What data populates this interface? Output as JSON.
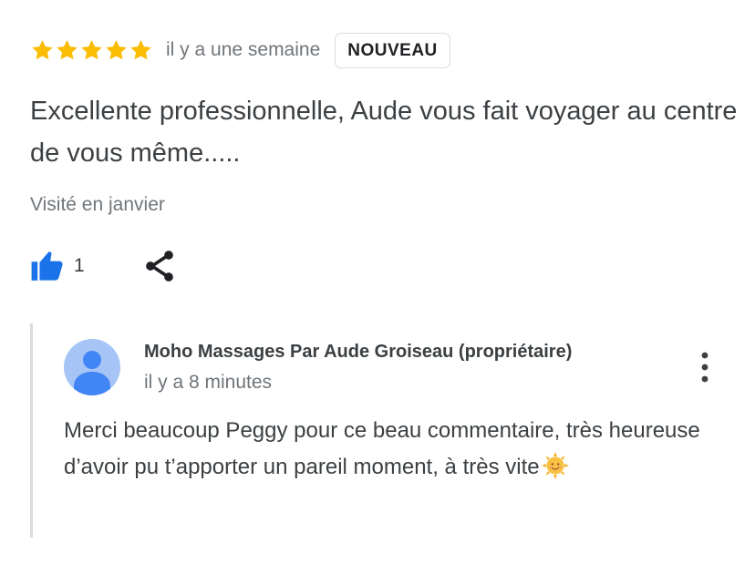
{
  "review": {
    "rating": 5,
    "time_ago": "il y a une semaine",
    "badge": "NOUVEAU",
    "text": "Excellente professionnelle, Aude vous fait voyager au centre de vous même.....",
    "visited": "Visité en janvier",
    "like_count": "1",
    "star_color": "#fbbc04"
  },
  "owner_reply": {
    "author": "Moho Massages Par Aude Groiseau (propriétaire)",
    "time_ago": "il y a 8 minutes",
    "text": "Merci beaucoup Peggy pour ce beau commentaire, très heureuse d’avoir pu t’apporter un pareil moment, à très vite",
    "emoji": "sun-face-emoji"
  },
  "colors": {
    "like_blue": "#1a73e8",
    "avatar_bg": "#a6c5f6",
    "avatar_fg": "#4285f4",
    "muted_text": "#70757a",
    "body_text": "#3c4043"
  },
  "icons": {
    "star": "star-icon",
    "like": "thumbs-up-icon",
    "share": "share-icon",
    "more": "more-vert-icon",
    "avatar": "person-icon"
  }
}
